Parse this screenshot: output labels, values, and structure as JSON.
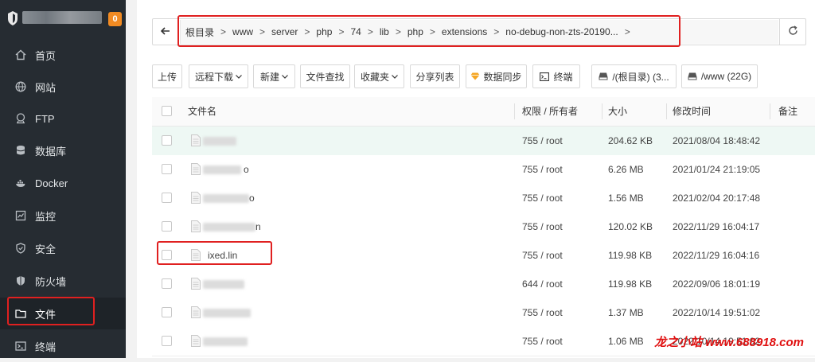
{
  "sidebar": {
    "badge": "0",
    "items": [
      {
        "label": "首页",
        "icon": "home-icon"
      },
      {
        "label": "网站",
        "icon": "globe-icon"
      },
      {
        "label": "FTP",
        "icon": "ftp-icon"
      },
      {
        "label": "数据库",
        "icon": "database-icon"
      },
      {
        "label": "Docker",
        "icon": "docker-icon"
      },
      {
        "label": "监控",
        "icon": "monitor-icon"
      },
      {
        "label": "安全",
        "icon": "shield-icon"
      },
      {
        "label": "防火墙",
        "icon": "firewall-icon"
      },
      {
        "label": "文件",
        "icon": "folder-icon",
        "active": true
      },
      {
        "label": "终端",
        "icon": "terminal-icon"
      }
    ]
  },
  "path": {
    "crumbs": [
      "根目录",
      "www",
      "server",
      "php",
      "74",
      "lib",
      "php",
      "extensions",
      "no-debug-non-zts-20190..."
    ],
    "separator": ">",
    "back_icon": "arrow-left-icon",
    "refresh_icon": "refresh-icon"
  },
  "toolbar": {
    "upload": "上传",
    "remote_download": "远程下载",
    "new": "新建",
    "find": "文件查找",
    "favorites": "收藏夹",
    "share_list": "分享列表",
    "data_sync": "数据同步",
    "terminal": "终端",
    "disk_root": "/(根目录) (3...",
    "disk_www": "/www (22G)"
  },
  "table": {
    "headers": {
      "name": "文件名",
      "perm": "权限 / 所有者",
      "size": "大小",
      "mtime": "修改时间",
      "note": "备注"
    },
    "rows": [
      {
        "name": "",
        "perm": "755 / root",
        "size": "204.62 KB",
        "mtime": "2021/08/04 18:48:42"
      },
      {
        "name": "o",
        "perm": "755 / root",
        "size": "6.26 MB",
        "mtime": "2021/01/24 21:19:05"
      },
      {
        "name": "o",
        "perm": "755 / root",
        "size": "1.56 MB",
        "mtime": "2021/02/04 20:17:48"
      },
      {
        "name": "n",
        "perm": "755 / root",
        "size": "120.02 KB",
        "mtime": "2022/11/29 16:04:17"
      },
      {
        "name": "ixed.lin",
        "perm": "755 / root",
        "size": "119.98 KB",
        "mtime": "2022/11/29 16:04:16"
      },
      {
        "name": "",
        "perm": "644 / root",
        "size": "119.98 KB",
        "mtime": "2022/09/06 18:01:19"
      },
      {
        "name": "",
        "perm": "755 / root",
        "size": "1.37 MB",
        "mtime": "2022/10/14 19:51:02"
      },
      {
        "name": "",
        "perm": "755 / root",
        "size": "1.06 MB",
        "mtime": "2022/10/14 19:51:02"
      }
    ]
  },
  "watermark": "龙之小站 www.688918.com",
  "colors": {
    "sidebar_bg": "#262c32",
    "badge": "#f28b22",
    "highlight_box": "#e02020",
    "row_highlight": "#eef8f4"
  }
}
